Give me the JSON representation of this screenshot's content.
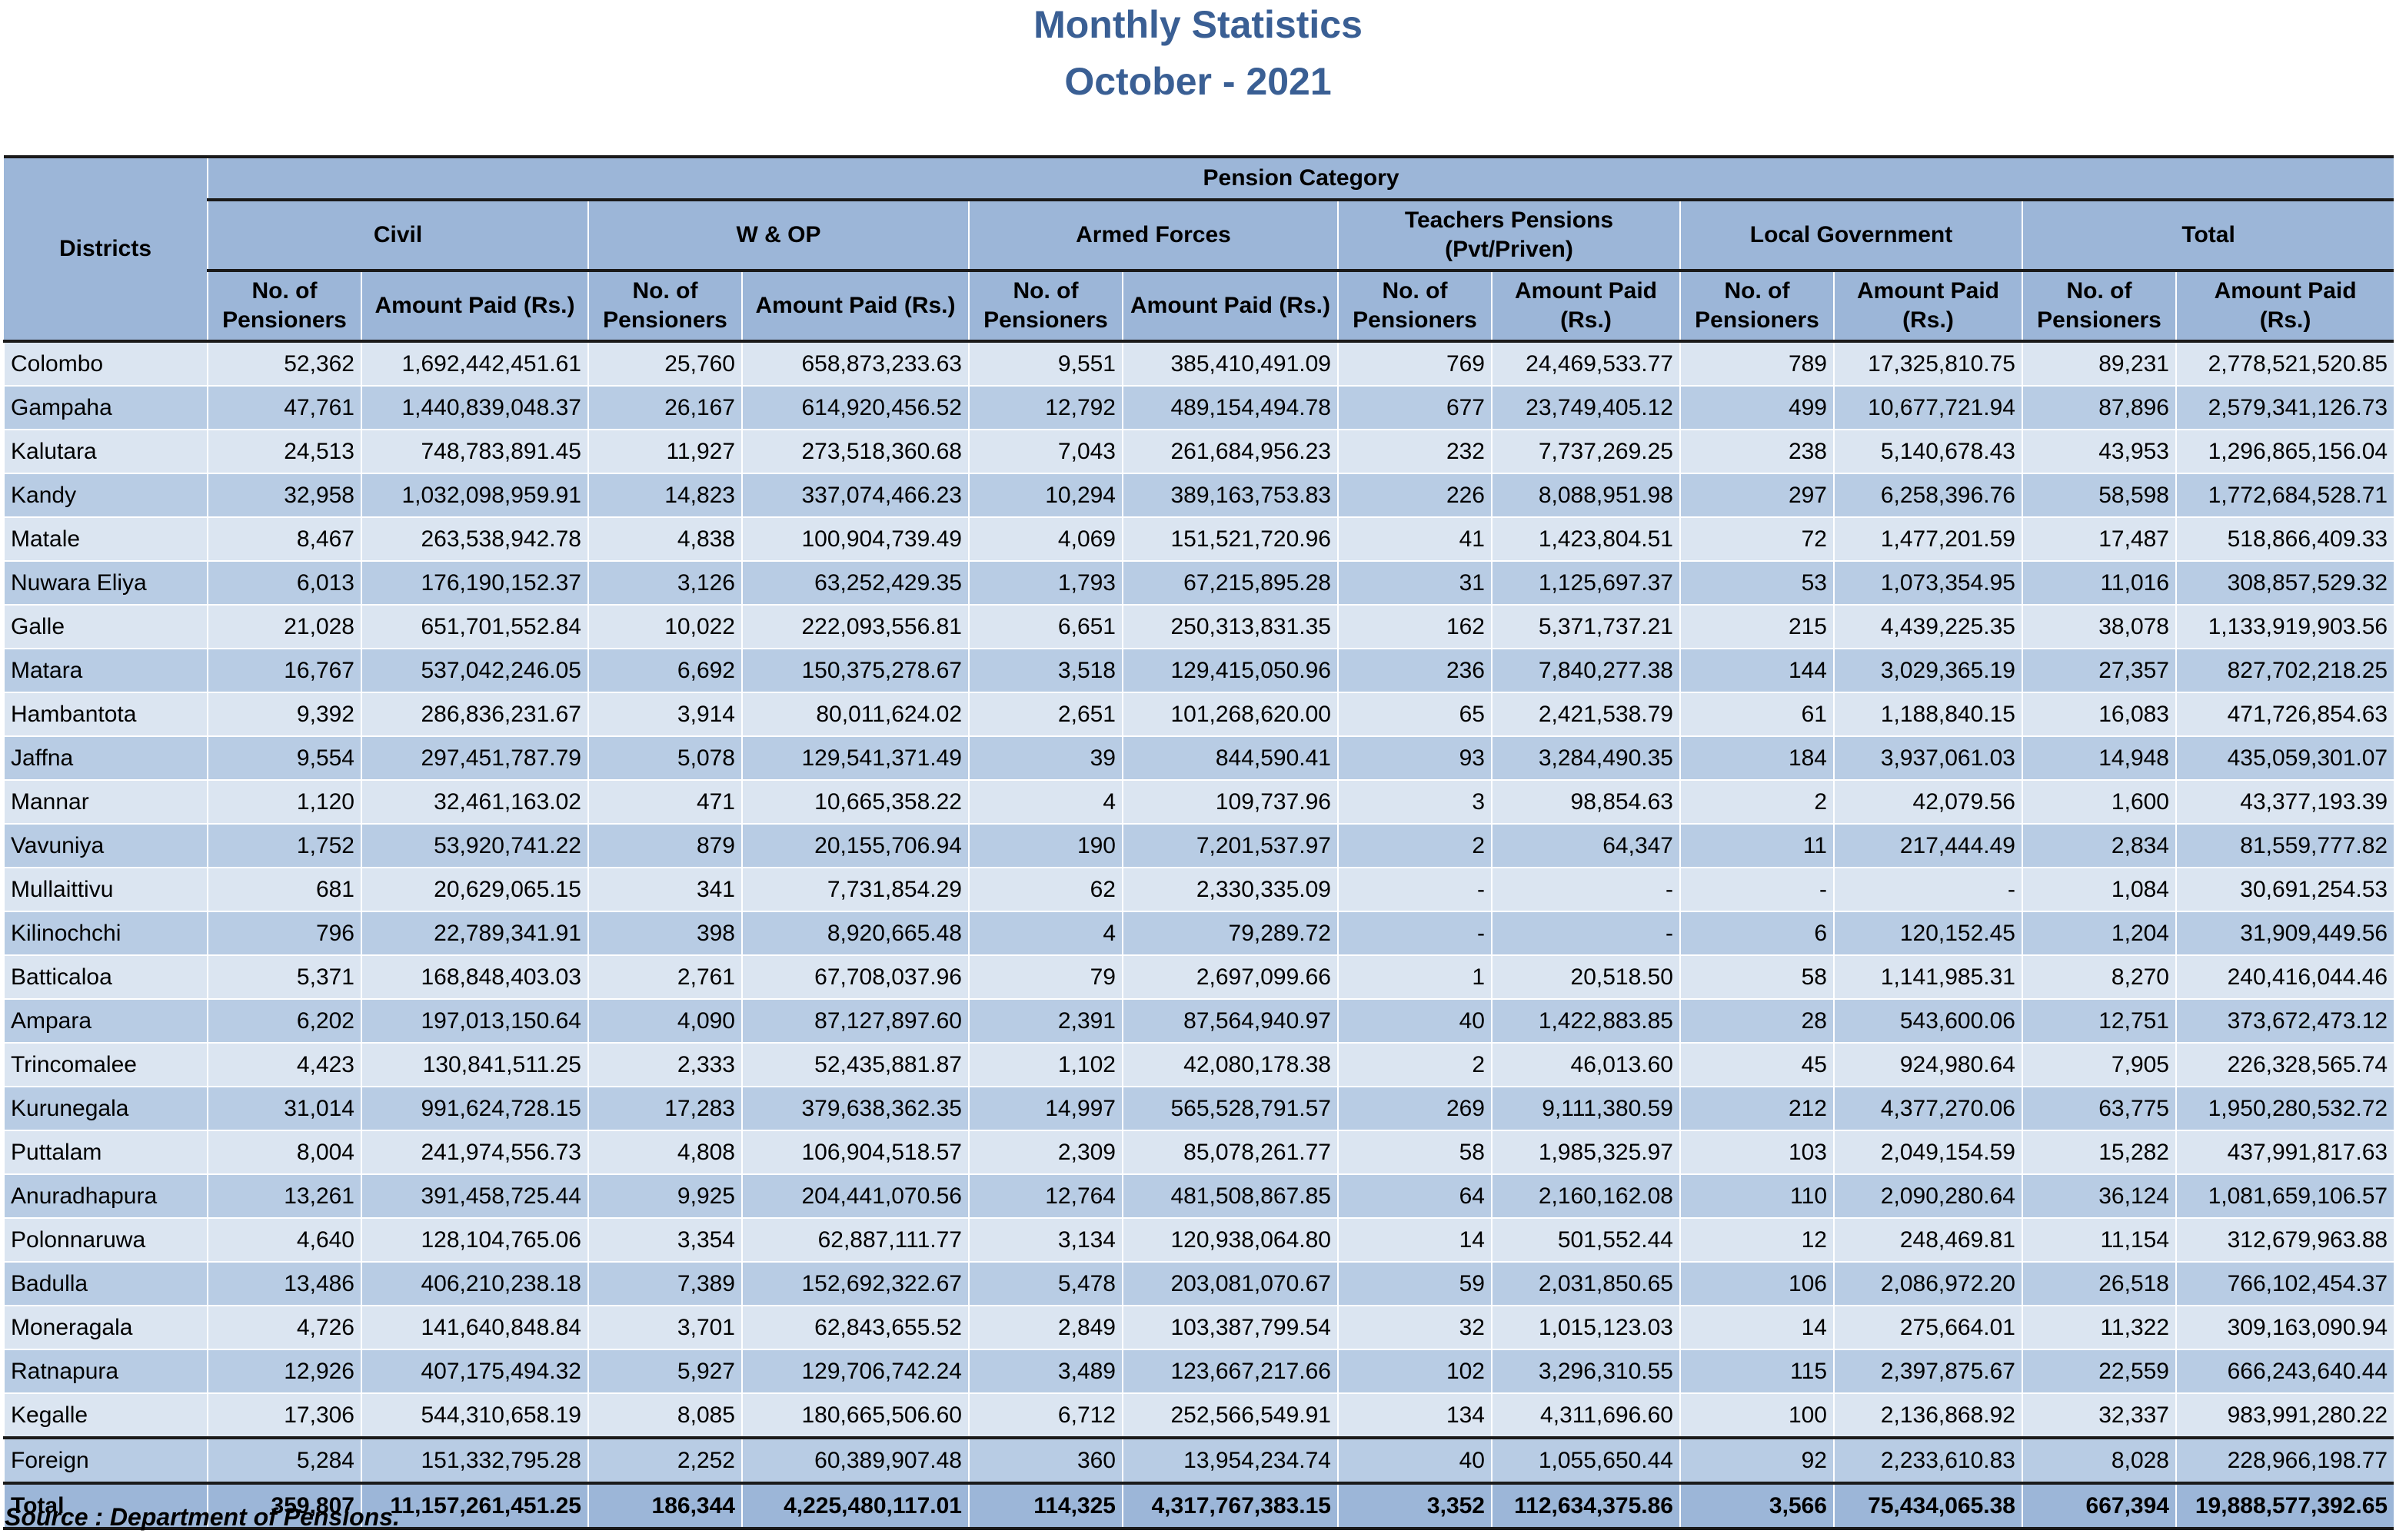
{
  "title_line1": "Monthly Statistics",
  "title_line2": "October - 2021",
  "header": {
    "districts": "Districts",
    "pension_category": "Pension Category",
    "groups": [
      {
        "line1": "Civil",
        "line2": ""
      },
      {
        "line1": "W & OP",
        "line2": ""
      },
      {
        "line1": "Armed Forces",
        "line2": ""
      },
      {
        "line1": "Teachers Pensions",
        "line2": "(Pvt/Priven)"
      },
      {
        "line1": "Local Government",
        "line2": ""
      },
      {
        "line1": "Total",
        "line2": ""
      }
    ],
    "subcols": [
      {
        "line1": "No. of",
        "line2": "Pensioners"
      },
      {
        "line1": "Amount Paid   (Rs.)",
        "line2": ""
      },
      {
        "line1": "No. of",
        "line2": "Pensioners"
      },
      {
        "line1": "Amount Paid (Rs.)",
        "line2": ""
      },
      {
        "line1": "No. of",
        "line2": "Pensioners"
      },
      {
        "line1": "Amount Paid (Rs.)",
        "line2": ""
      },
      {
        "line1": "No. of",
        "line2": "Pensioners"
      },
      {
        "line1": "Amount Paid",
        "line2": "(Rs.)"
      },
      {
        "line1": "No. of",
        "line2": "Pensioners"
      },
      {
        "line1": "Amount Paid",
        "line2": "(Rs.)"
      },
      {
        "line1": "No. of",
        "line2": "Pensioners"
      },
      {
        "line1": "Amount Paid",
        "line2": "(Rs.)"
      }
    ]
  },
  "rows": [
    {
      "district": "Colombo",
      "values": [
        "52,362",
        "1,692,442,451.61",
        "25,760",
        "658,873,233.63",
        "9,551",
        "385,410,491.09",
        "769",
        "24,469,533.77",
        "789",
        "17,325,810.75",
        "89,231",
        "2,778,521,520.85"
      ]
    },
    {
      "district": "Gampaha",
      "values": [
        "47,761",
        "1,440,839,048.37",
        "26,167",
        "614,920,456.52",
        "12,792",
        "489,154,494.78",
        "677",
        "23,749,405.12",
        "499",
        "10,677,721.94",
        "87,896",
        "2,579,341,126.73"
      ]
    },
    {
      "district": "Kalutara",
      "values": [
        "24,513",
        "748,783,891.45",
        "11,927",
        "273,518,360.68",
        "7,043",
        "261,684,956.23",
        "232",
        "7,737,269.25",
        "238",
        "5,140,678.43",
        "43,953",
        "1,296,865,156.04"
      ]
    },
    {
      "district": "Kandy",
      "values": [
        "32,958",
        "1,032,098,959.91",
        "14,823",
        "337,074,466.23",
        "10,294",
        "389,163,753.83",
        "226",
        "8,088,951.98",
        "297",
        "6,258,396.76",
        "58,598",
        "1,772,684,528.71"
      ]
    },
    {
      "district": "Matale",
      "values": [
        "8,467",
        "263,538,942.78",
        "4,838",
        "100,904,739.49",
        "4,069",
        "151,521,720.96",
        "41",
        "1,423,804.51",
        "72",
        "1,477,201.59",
        "17,487",
        "518,866,409.33"
      ]
    },
    {
      "district": "Nuwara Eliya",
      "values": [
        "6,013",
        "176,190,152.37",
        "3,126",
        "63,252,429.35",
        "1,793",
        "67,215,895.28",
        "31",
        "1,125,697.37",
        "53",
        "1,073,354.95",
        "11,016",
        "308,857,529.32"
      ]
    },
    {
      "district": "Galle",
      "values": [
        "21,028",
        "651,701,552.84",
        "10,022",
        "222,093,556.81",
        "6,651",
        "250,313,831.35",
        "162",
        "5,371,737.21",
        "215",
        "4,439,225.35",
        "38,078",
        "1,133,919,903.56"
      ]
    },
    {
      "district": "Matara",
      "values": [
        "16,767",
        "537,042,246.05",
        "6,692",
        "150,375,278.67",
        "3,518",
        "129,415,050.96",
        "236",
        "7,840,277.38",
        "144",
        "3,029,365.19",
        "27,357",
        "827,702,218.25"
      ]
    },
    {
      "district": "Hambantota",
      "values": [
        "9,392",
        "286,836,231.67",
        "3,914",
        "80,011,624.02",
        "2,651",
        "101,268,620.00",
        "65",
        "2,421,538.79",
        "61",
        "1,188,840.15",
        "16,083",
        "471,726,854.63"
      ]
    },
    {
      "district": "Jaffna",
      "values": [
        "9,554",
        "297,451,787.79",
        "5,078",
        "129,541,371.49",
        "39",
        "844,590.41",
        "93",
        "3,284,490.35",
        "184",
        "3,937,061.03",
        "14,948",
        "435,059,301.07"
      ]
    },
    {
      "district": "Mannar",
      "values": [
        "1,120",
        "32,461,163.02",
        "471",
        "10,665,358.22",
        "4",
        "109,737.96",
        "3",
        "98,854.63",
        "2",
        "42,079.56",
        "1,600",
        "43,377,193.39"
      ]
    },
    {
      "district": "Vavuniya",
      "values": [
        "1,752",
        "53,920,741.22",
        "879",
        "20,155,706.94",
        "190",
        "7,201,537.97",
        "2",
        "64,347",
        "11",
        "217,444.49",
        "2,834",
        "81,559,777.82"
      ]
    },
    {
      "district": "Mullaittivu",
      "values": [
        "681",
        "20,629,065.15",
        "341",
        "7,731,854.29",
        "62",
        "2,330,335.09",
        "-",
        "-",
        "-",
        "-",
        "1,084",
        "30,691,254.53"
      ]
    },
    {
      "district": "Kilinochchi",
      "values": [
        "796",
        "22,789,341.91",
        "398",
        "8,920,665.48",
        "4",
        "79,289.72",
        "-",
        "-",
        "6",
        "120,152.45",
        "1,204",
        "31,909,449.56"
      ]
    },
    {
      "district": "Batticaloa",
      "values": [
        "5,371",
        "168,848,403.03",
        "2,761",
        "67,708,037.96",
        "79",
        "2,697,099.66",
        "1",
        "20,518.50",
        "58",
        "1,141,985.31",
        "8,270",
        "240,416,044.46"
      ]
    },
    {
      "district": "Ampara",
      "values": [
        "6,202",
        "197,013,150.64",
        "4,090",
        "87,127,897.60",
        "2,391",
        "87,564,940.97",
        "40",
        "1,422,883.85",
        "28",
        "543,600.06",
        "12,751",
        "373,672,473.12"
      ]
    },
    {
      "district": "Trincomalee",
      "values": [
        "4,423",
        "130,841,511.25",
        "2,333",
        "52,435,881.87",
        "1,102",
        "42,080,178.38",
        "2",
        "46,013.60",
        "45",
        "924,980.64",
        "7,905",
        "226,328,565.74"
      ]
    },
    {
      "district": "Kurunegala",
      "values": [
        "31,014",
        "991,624,728.15",
        "17,283",
        "379,638,362.35",
        "14,997",
        "565,528,791.57",
        "269",
        "9,111,380.59",
        "212",
        "4,377,270.06",
        "63,775",
        "1,950,280,532.72"
      ]
    },
    {
      "district": "Puttalam",
      "values": [
        "8,004",
        "241,974,556.73",
        "4,808",
        "106,904,518.57",
        "2,309",
        "85,078,261.77",
        "58",
        "1,985,325.97",
        "103",
        "2,049,154.59",
        "15,282",
        "437,991,817.63"
      ]
    },
    {
      "district": "Anuradhapura",
      "values": [
        "13,261",
        "391,458,725.44",
        "9,925",
        "204,441,070.56",
        "12,764",
        "481,508,867.85",
        "64",
        "2,160,162.08",
        "110",
        "2,090,280.64",
        "36,124",
        "1,081,659,106.57"
      ]
    },
    {
      "district": "Polonnaruwa",
      "values": [
        "4,640",
        "128,104,765.06",
        "3,354",
        "62,887,111.77",
        "3,134",
        "120,938,064.80",
        "14",
        "501,552.44",
        "12",
        "248,469.81",
        "11,154",
        "312,679,963.88"
      ]
    },
    {
      "district": "Badulla",
      "values": [
        "13,486",
        "406,210,238.18",
        "7,389",
        "152,692,322.67",
        "5,478",
        "203,081,070.67",
        "59",
        "2,031,850.65",
        "106",
        "2,086,972.20",
        "26,518",
        "766,102,454.37"
      ]
    },
    {
      "district": "Moneragala",
      "values": [
        "4,726",
        "141,640,848.84",
        "3,701",
        "62,843,655.52",
        "2,849",
        "103,387,799.54",
        "32",
        "1,015,123.03",
        "14",
        "275,664.01",
        "11,322",
        "309,163,090.94"
      ]
    },
    {
      "district": "Ratnapura",
      "values": [
        "12,926",
        "407,175,494.32",
        "5,927",
        "129,706,742.24",
        "3,489",
        "123,667,217.66",
        "102",
        "3,296,310.55",
        "115",
        "2,397,875.67",
        "22,559",
        "666,243,640.44"
      ]
    },
    {
      "district": "Kegalle",
      "values": [
        "17,306",
        "544,310,658.19",
        "8,085",
        "180,665,506.60",
        "6,712",
        "252,566,549.91",
        "134",
        "4,311,696.60",
        "100",
        "2,136,868.92",
        "32,337",
        "983,991,280.22"
      ]
    },
    {
      "district": "Foreign",
      "values": [
        "5,284",
        "151,332,795.28",
        "2,252",
        "60,389,907.48",
        "360",
        "13,954,234.74",
        "40",
        "1,055,650.44",
        "92",
        "2,233,610.83",
        "8,028",
        "228,966,198.77"
      ]
    }
  ],
  "total": {
    "label": "Total",
    "values": [
      "359,807",
      "11,157,261,451.25",
      "186,344",
      "4,225,480,117.01",
      "114,325",
      "4,317,767,383.15",
      "3,352",
      "112,634,375.86",
      "3,566",
      "75,434,065.38",
      "667,394",
      "19,888,577,392.65"
    ]
  },
  "source": "Source : Department of Pensions."
}
